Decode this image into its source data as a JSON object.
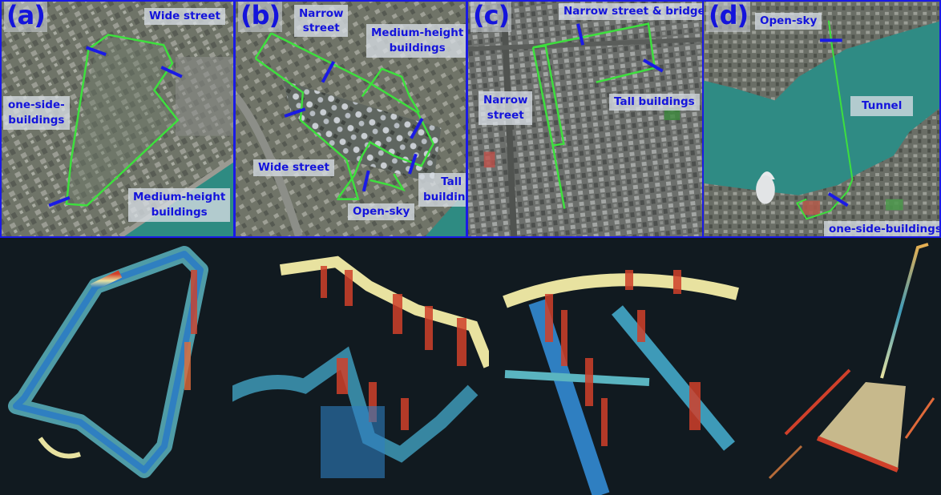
{
  "figure": {
    "description": "Four test scenarios with satellite route maps (top) and corresponding 3D LiDAR point-cloud maps (bottom)",
    "colors": {
      "label_text": "#1414dc",
      "panel_border": "#1a1ae6",
      "route_line": "#3de03d",
      "marker": "#1a1ae6",
      "cloud_background": "#111a20",
      "cloud_low": "#2f7fc1",
      "cloud_mid": "#e8e2a0",
      "cloud_high": "#d0402a"
    },
    "panels": [
      {
        "letter": "(a)",
        "labels": [
          "Wide street",
          "one-side-\nbuildings",
          "Medium-height\nbuildings"
        ],
        "label_lines": [
          [
            "Wide street"
          ],
          [
            "one-side-",
            "buildings"
          ],
          [
            "Medium-height",
            "buildings"
          ]
        ],
        "marker_count": 3
      },
      {
        "letter": "(b)",
        "label_lines": [
          [
            "Narrow",
            "street"
          ],
          [
            "Medium-height",
            "buildings"
          ],
          [
            "Wide street"
          ],
          [
            "Tall",
            "buildings"
          ],
          [
            "Open-sky"
          ]
        ],
        "marker_count": 5
      },
      {
        "letter": "(c)",
        "label_lines": [
          [
            "Narrow street & bridge"
          ],
          [
            "Narrow",
            "street"
          ],
          [
            "Tall buildings"
          ]
        ],
        "marker_count": 2
      },
      {
        "letter": "(d)",
        "label_lines": [
          [
            "Open-sky"
          ],
          [
            "Tunnel"
          ],
          [
            "one-side-buildings"
          ]
        ],
        "marker_count": 2
      }
    ]
  }
}
